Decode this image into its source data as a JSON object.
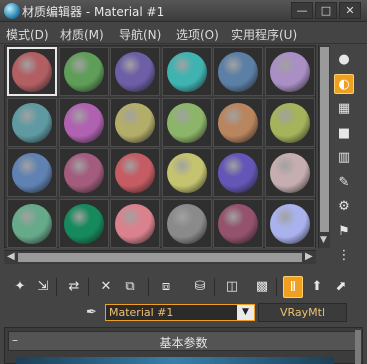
{
  "window": {
    "title": "材质编辑器 - Material #1",
    "icon": "material-editor-app-icon",
    "controls": {
      "minimize": "—",
      "maximize": "□",
      "close": "✕"
    }
  },
  "menu": {
    "items": [
      "模式(D)",
      "材质(M)",
      "导航(N)",
      "选项(O)",
      "实用程序(U)"
    ]
  },
  "sample_slots": {
    "columns": 6,
    "rows": 4,
    "selected_index": 0,
    "colors": [
      "#b25f63",
      "#5f9e59",
      "#6e5ea7",
      "#3fb3b0",
      "#5c7fa6",
      "#a98fc3",
      "#5f9aa2",
      "#b062b0",
      "#b3ad6a",
      "#8db56a",
      "#b8855e",
      "#a4b35c",
      "#5f82b2",
      "#a35c7e",
      "#c55b63",
      "#c4c36f",
      "#6356b6",
      "#c6aeb0",
      "#66aa8a",
      "#168a5c",
      "#d9828e",
      "#8a8a8a",
      "#94526c",
      "#a9b2ec"
    ]
  },
  "side_tools": [
    {
      "name": "sample-type-icon",
      "glyph": "●"
    },
    {
      "name": "backlight-icon",
      "glyph": "◐"
    },
    {
      "name": "background-icon",
      "glyph": "▦"
    },
    {
      "name": "sample-uv-tiling-icon",
      "glyph": "■"
    },
    {
      "name": "video-color-check-icon",
      "glyph": "▥"
    },
    {
      "name": "make-preview-icon",
      "glyph": "✎"
    },
    {
      "name": "options-icon",
      "glyph": "⚙"
    },
    {
      "name": "select-by-material-icon",
      "glyph": "⚑"
    },
    {
      "name": "material-map-navigator-icon",
      "glyph": "⋮"
    }
  ],
  "toolbar": {
    "tools": [
      {
        "name": "get-material-icon",
        "glyph": "✦"
      },
      {
        "name": "put-to-scene-icon",
        "glyph": "⇲"
      },
      {
        "name": "assign-to-selection-icon",
        "glyph": "⇄"
      },
      {
        "name": "reset-map-icon",
        "glyph": "✕"
      },
      {
        "name": "copy-material-icon",
        "glyph": "⧉"
      },
      {
        "name": "make-unique-icon",
        "glyph": "⧈"
      },
      {
        "name": "put-to-library-icon",
        "glyph": "⛁"
      },
      {
        "name": "material-id-channel-icon",
        "glyph": "◫"
      },
      {
        "name": "show-shaded-material-icon",
        "glyph": "▩"
      },
      {
        "name": "show-end-result-icon",
        "glyph": "Ⅱ"
      },
      {
        "name": "go-to-parent-icon",
        "glyph": "⬆"
      },
      {
        "name": "go-forward-to-sibling-icon",
        "glyph": "⬈"
      }
    ]
  },
  "material": {
    "name": "Material #1",
    "type": "VRayMtl",
    "picker_icon": "eyedropper-icon"
  },
  "rollout": {
    "title": "基本参数",
    "toggle": "–"
  },
  "accent_color": "#f0a020"
}
